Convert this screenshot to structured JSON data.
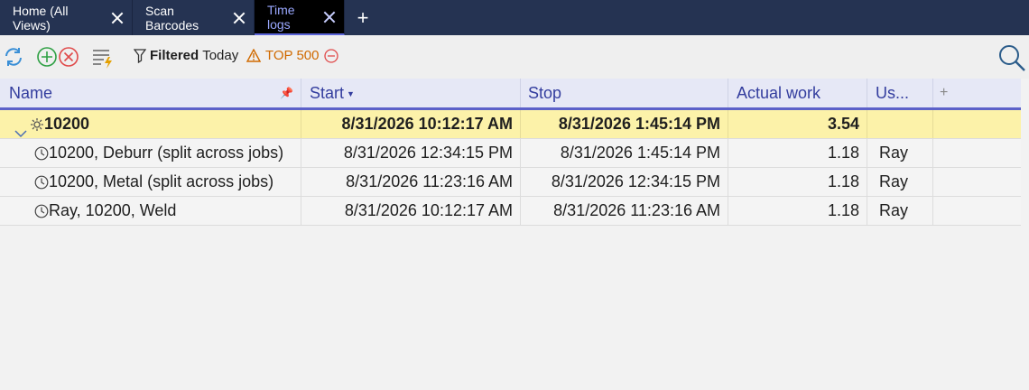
{
  "tabs": [
    {
      "label": "Home (All Views)",
      "active": false
    },
    {
      "label": "Scan Barcodes",
      "active": false
    },
    {
      "label": "Time logs",
      "active": true
    }
  ],
  "new_tab_label": "+",
  "toolbar": {
    "filter_label": "Filtered",
    "filter_value": "Today",
    "top_label": "TOP 500"
  },
  "columns": {
    "name": "Name",
    "start": "Start",
    "stop": "Stop",
    "actual": "Actual work",
    "user": "Us...",
    "add": "+"
  },
  "group_row": {
    "name": "10200",
    "start": "8/31/2026 10:12:17 AM",
    "stop": "8/31/2026 1:45:14 PM",
    "actual": "3.54",
    "user": ""
  },
  "rows": [
    {
      "name": "10200, Deburr (split across jobs)",
      "start": "8/31/2026 12:34:15 PM",
      "stop": "8/31/2026 1:45:14 PM",
      "actual": "1.18",
      "user": "Ray"
    },
    {
      "name": "10200, Metal (split across jobs)",
      "start": "8/31/2026 11:23:16 AM",
      "stop": "8/31/2026 12:34:15 PM",
      "actual": "1.18",
      "user": "Ray"
    },
    {
      "name": "Ray, 10200, Weld",
      "start": "8/31/2026 10:12:17 AM",
      "stop": "8/31/2026 11:23:16 AM",
      "actual": "1.18",
      "user": "Ray"
    }
  ],
  "colors": {
    "tabbar": "#253352",
    "active_tab_text": "#9aa8ff",
    "header_text": "#333d9e",
    "group_row_bg": "#fcf2a9",
    "warning": "#d06a00"
  }
}
